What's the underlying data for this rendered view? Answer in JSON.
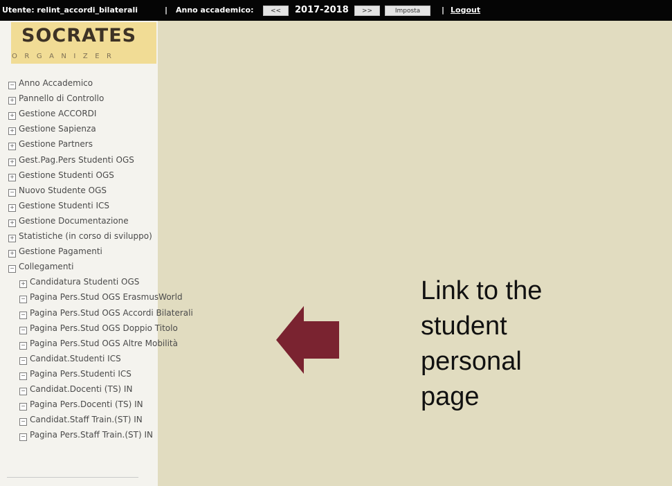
{
  "topbar": {
    "user_text": "Utente: relint_accordi_bilaterali",
    "divider": "|",
    "year_label": "Anno accademico:",
    "prev_button": "<<",
    "year_value": "2017-2018",
    "next_button": ">>",
    "set_button": "Imposta",
    "divider2": "|",
    "logout_link": "Logout"
  },
  "logo": {
    "title": "SOCRATES",
    "subtitle": "ORGANIZER"
  },
  "menu": [
    {
      "label": "Anno Accademico",
      "icon": "minus-box-icon",
      "indent": 0
    },
    {
      "label": "Pannello di Controllo",
      "icon": "plus-box-icon",
      "indent": 0
    },
    {
      "label": "Gestione ACCORDI",
      "icon": "plus-box-icon",
      "indent": 0
    },
    {
      "label": "Gestione Sapienza",
      "icon": "plus-box-icon",
      "indent": 0
    },
    {
      "label": "Gestione Partners",
      "icon": "plus-box-icon",
      "indent": 0
    },
    {
      "label": "Gest.Pag.Pers Studenti OGS",
      "icon": "plus-box-icon",
      "indent": 0
    },
    {
      "label": "Gestione Studenti OGS",
      "icon": "plus-box-icon",
      "indent": 0
    },
    {
      "label": "Nuovo Studente OGS",
      "icon": "minus-box-icon",
      "indent": 0
    },
    {
      "label": "Gestione Studenti ICS",
      "icon": "plus-box-icon",
      "indent": 0
    },
    {
      "label": "Gestione Documentazione",
      "icon": "plus-box-icon",
      "indent": 0
    },
    {
      "label": "Statistiche (in corso di sviluppo)",
      "icon": "plus-box-icon",
      "indent": 0
    },
    {
      "label": "Gestione Pagamenti",
      "icon": "plus-box-icon",
      "indent": 0
    },
    {
      "label": "Collegamenti",
      "icon": "minus-box-icon",
      "indent": 0
    },
    {
      "label": "Candidatura Studenti OGS",
      "icon": "plus-box-icon",
      "indent": 1
    },
    {
      "label": "Pagina Pers.Stud OGS ErasmusWorld",
      "icon": "minus-box-icon",
      "indent": 1
    },
    {
      "label": "Pagina Pers.Stud OGS Accordi Bilaterali",
      "icon": "minus-box-icon",
      "indent": 1
    },
    {
      "label": "Pagina Pers.Stud OGS Doppio Titolo",
      "icon": "minus-box-icon",
      "indent": 1
    },
    {
      "label": "Pagina Pers.Stud OGS Altre Mobilità",
      "icon": "minus-box-icon",
      "indent": 1
    },
    {
      "label": "Candidat.Studenti ICS",
      "icon": "minus-box-icon",
      "indent": 1
    },
    {
      "label": "Pagina Pers.Studenti ICS",
      "icon": "minus-box-icon",
      "indent": 1
    },
    {
      "label": "Candidat.Docenti (TS) IN",
      "icon": "minus-box-icon",
      "indent": 1
    },
    {
      "label": "Pagina Pers.Docenti (TS) IN",
      "icon": "minus-box-icon",
      "indent": 1
    },
    {
      "label": "Candidat.Staff Train.(ST) IN",
      "icon": "minus-box-icon",
      "indent": 1
    },
    {
      "label": "Pagina Pers.Staff Train.(ST) IN",
      "icon": "minus-box-icon",
      "indent": 1
    }
  ],
  "annotation": {
    "lines": [
      "Link to the",
      "student",
      "personal",
      "page"
    ],
    "arrow_icon": "left-arrow-icon",
    "arrow_color": "#7a2330"
  },
  "colors": {
    "topbar": "#050505",
    "main_bg": "#e1dcc0",
    "sidebar_bg": "#f4f3ee",
    "logo_bg": "#f1dc95"
  }
}
